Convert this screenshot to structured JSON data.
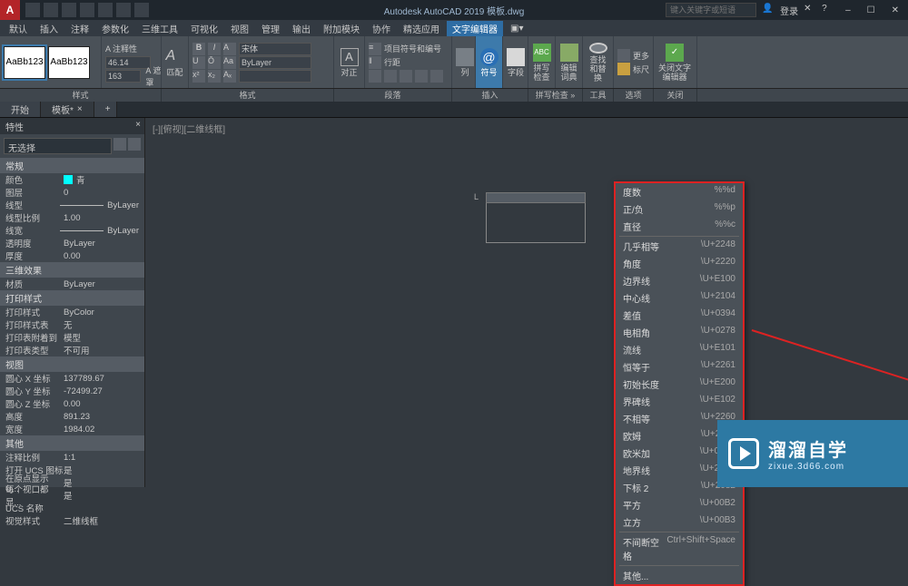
{
  "title": "Autodesk AutoCAD 2019   模板.dwg",
  "search_placeholder": "键入关键字或短语",
  "login": "登录",
  "menu": [
    "默认",
    "插入",
    "注释",
    "参数化",
    "三维工具",
    "可视化",
    "视图",
    "管理",
    "输出",
    "附加模块",
    "协作",
    "精选应用",
    "文字编辑器"
  ],
  "ribbon": {
    "style_panel": "样式",
    "fmt_panel": "格式",
    "para_panel": "段落",
    "insert_panel": "插入",
    "spell_panel": "拼写检查 »",
    "tools_panel": "工具",
    "opt_panel": "选项",
    "close_panel": "关闭",
    "sample1": "AaBb123",
    "sample2": "AaBb123",
    "annotative": "A 注释性",
    "h1": "46.14",
    "h2": "163",
    "mask": "A 遮罩",
    "match": "匹配",
    "font": "宋体",
    "align": "对正",
    "bullets": "项目符号和编号",
    "linespace": "行距",
    "cols": "列",
    "symbol": "符号",
    "field": "字段",
    "spell": "拼写检查",
    "dict": "编辑词典",
    "find": "查找和替换",
    "more": "更多",
    "ruler": "标尺",
    "ok": "关闭文字编辑器"
  },
  "tabs": {
    "start": "开始",
    "doc": "模板*"
  },
  "props": {
    "title": "特性",
    "nosel": "无选择",
    "sects": {
      "general": "常规",
      "fx3d": "三维效果",
      "plot": "打印样式",
      "view": "视图",
      "misc": "其他"
    },
    "rows": {
      "color_k": "颜色",
      "color_v": "青",
      "layer_k": "图层",
      "layer_v": "0",
      "ltype_k": "线型",
      "ltype_v": "ByLayer",
      "ltscale_k": "线型比例",
      "ltscale_v": "1.00",
      "lweight_k": "线宽",
      "lweight_v": "ByLayer",
      "trans_k": "透明度",
      "trans_v": "ByLayer",
      "thick_k": "厚度",
      "thick_v": "0.00",
      "mat_k": "材质",
      "mat_v": "ByLayer",
      "pstyle_k": "打印样式",
      "pstyle_v": "ByColor",
      "pstab_k": "打印样式表",
      "pstab_v": "无",
      "psatt_k": "打印表附着到",
      "psatt_v": "模型",
      "pstype_k": "打印表类型",
      "pstype_v": "不可用",
      "cx_k": "圆心 X 坐标",
      "cx_v": "137789.67",
      "cy_k": "圆心 Y 坐标",
      "cy_v": "-72499.27",
      "cz_k": "圆心 Z 坐标",
      "cz_v": "0.00",
      "ht_k": "高度",
      "ht_v": "891.23",
      "wd_k": "宽度",
      "wd_v": "1984.02",
      "asc_k": "注释比例",
      "asc_v": "1:1",
      "ucs_k": "打开 UCS 图标",
      "ucs_v": "是",
      "orig_k": "在原点显示 U...",
      "orig_v": "是",
      "vp_k": "每个视口都显...",
      "vp_v": "是",
      "ucsn_k": "UCS 名称",
      "ucsn_v": "",
      "vs_k": "视觉样式",
      "vs_v": "二维线框"
    }
  },
  "dwg_label": "[-][俯视][二维线框]",
  "symbols": [
    {
      "n": "度数",
      "c": "%%d"
    },
    {
      "n": "正/负",
      "c": "%%p"
    },
    {
      "n": "直径",
      "c": "%%c"
    },
    "-",
    {
      "n": "几乎相等",
      "c": "\\U+2248"
    },
    {
      "n": "角度",
      "c": "\\U+2220"
    },
    {
      "n": "边界线",
      "c": "\\U+E100"
    },
    {
      "n": "中心线",
      "c": "\\U+2104"
    },
    {
      "n": "差值",
      "c": "\\U+0394"
    },
    {
      "n": "电相角",
      "c": "\\U+0278"
    },
    {
      "n": "流线",
      "c": "\\U+E101"
    },
    {
      "n": "恒等于",
      "c": "\\U+2261"
    },
    {
      "n": "初始长度",
      "c": "\\U+E200"
    },
    {
      "n": "界碑线",
      "c": "\\U+E102"
    },
    {
      "n": "不相等",
      "c": "\\U+2260"
    },
    {
      "n": "欧姆",
      "c": "\\U+2126"
    },
    {
      "n": "欧米加",
      "c": "\\U+03A9"
    },
    {
      "n": "地界线",
      "c": "\\U+214A"
    },
    {
      "n": "下标 2",
      "c": "\\U+2082"
    },
    {
      "n": "平方",
      "c": "\\U+00B2"
    },
    {
      "n": "立方",
      "c": "\\U+00B3"
    },
    "-",
    {
      "n": "不间断空格",
      "c": "Ctrl+Shift+Space"
    },
    "-",
    {
      "n": "其他...",
      "c": ""
    }
  ],
  "watermark": {
    "l1": "溜溜自学",
    "l2": "zixue.3d66.com"
  }
}
